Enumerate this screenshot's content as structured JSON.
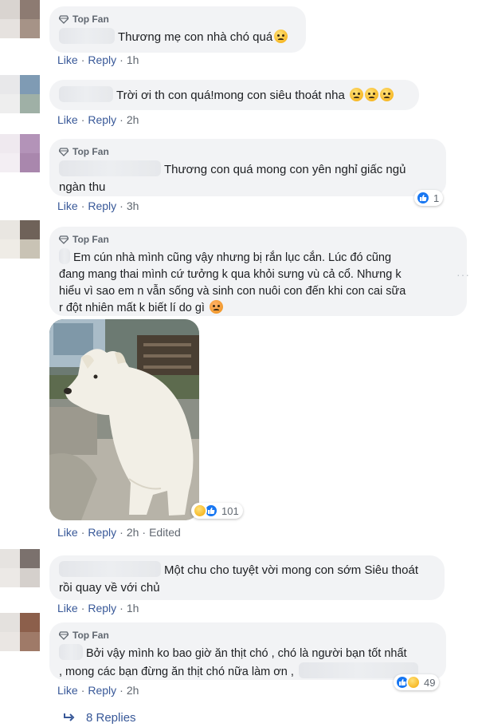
{
  "badge": {
    "top_fan": "Top Fan"
  },
  "actions": {
    "like": "Like",
    "reply": "Reply",
    "sep": "·",
    "edited": "Edited"
  },
  "comments": [
    {
      "text": "Thương mẹ con nhà chó quá",
      "emoji": "anxious-face-emoji",
      "time": "1h",
      "top_fan": true
    },
    {
      "text": "Trời ơi th con quá!mong con siêu thoát nha",
      "emoji": "sad-face-emoji x3",
      "time": "2h",
      "top_fan": false
    },
    {
      "text": "Thương con quá mong con yên nghỉ giấc ngủ",
      "text2": "ngàn thu",
      "time": "3h",
      "top_fan": true,
      "reactions": {
        "types": [
          "like"
        ],
        "count": "1"
      }
    },
    {
      "lines": [
        "Em cún nhà mình cũng vậy nhưng bị rắn lục cắn. Lúc đó cũng",
        "đang mang thai mình cứ tưởng k qua khỏi sưng vù cả cổ. Nhưng k",
        "hiểu vì sao em n vẫn sống và sinh con nuôi con đến khi con cai sữa",
        "r đột nhiên mất k biết lí do gì"
      ],
      "emoji": "sad-face-emoji",
      "time": "2h",
      "top_fan": true,
      "edited": true,
      "photo": "white-dog-photo",
      "reactions": {
        "types": [
          "sad",
          "like"
        ],
        "count": "101"
      }
    },
    {
      "text": "Một chu cho tuyệt vời mong con sớm Siêu thoát",
      "text2": "rồi quay về với chủ",
      "time": "1h",
      "top_fan": false
    },
    {
      "text": "Bởi vậy mình ko bao giờ ăn thịt chó , chó là người bạn tốt nhất",
      "text2": ", mong các bạn đừng ăn thịt chó nữa làm ơn ,",
      "time": "2h",
      "top_fan": true,
      "reactions": {
        "types": [
          "like",
          "haha"
        ],
        "count": "49"
      }
    }
  ],
  "replies": {
    "label": "8 Replies"
  },
  "more_options": "···"
}
